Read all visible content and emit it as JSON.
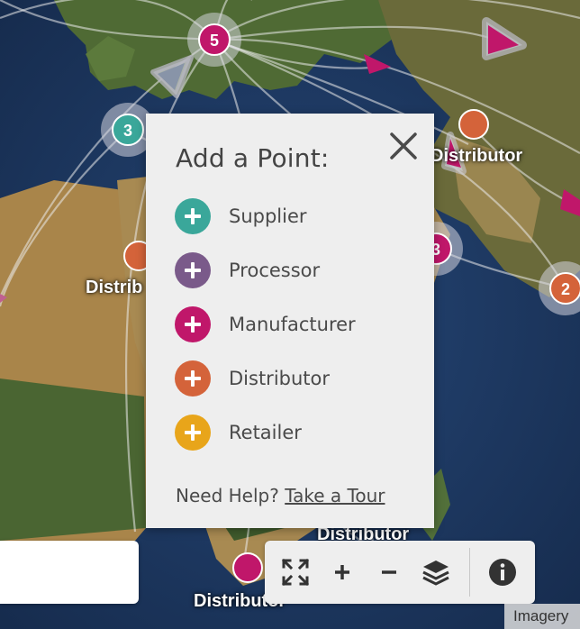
{
  "colors": {
    "supplier": "#3aa79a",
    "processor": "#7a5a8a",
    "manufacturer": "#c0176a",
    "distributor": "#d4633a",
    "retailer": "#e8a51a"
  },
  "map": {
    "clusters": [
      {
        "label": "5",
        "type": "manufacturer"
      },
      {
        "label": "3",
        "type": "supplier"
      },
      {
        "label": "3",
        "type": "manufacturer"
      },
      {
        "label": "2",
        "type": "distributor"
      }
    ],
    "labels": {
      "distributor_top_right": "Distributor",
      "distributor_left": "Distrib",
      "distributor_bottom_mid": "Distributor",
      "distributor_bottom": "Distributor"
    }
  },
  "popup": {
    "title": "Add a Point:",
    "close_icon": "close-icon",
    "items": [
      {
        "label": "Supplier",
        "icon": "plus-icon",
        "color": "#3aa79a"
      },
      {
        "label": "Processor",
        "icon": "plus-icon",
        "color": "#7a5a8a"
      },
      {
        "label": "Manufacturer",
        "icon": "plus-icon",
        "color": "#c0176a"
      },
      {
        "label": "Distributor",
        "icon": "plus-icon",
        "color": "#d4633a"
      },
      {
        "label": "Retailer",
        "icon": "plus-icon",
        "color": "#e8a51a"
      }
    ],
    "help_prefix": "Need Help?",
    "help_link": "Take a Tour"
  },
  "toolbar": {
    "buttons": [
      "fullscreen-icon",
      "zoom-in-icon",
      "zoom-out-icon",
      "layers-icon",
      "info-icon"
    ]
  },
  "attribution": "Imagery"
}
